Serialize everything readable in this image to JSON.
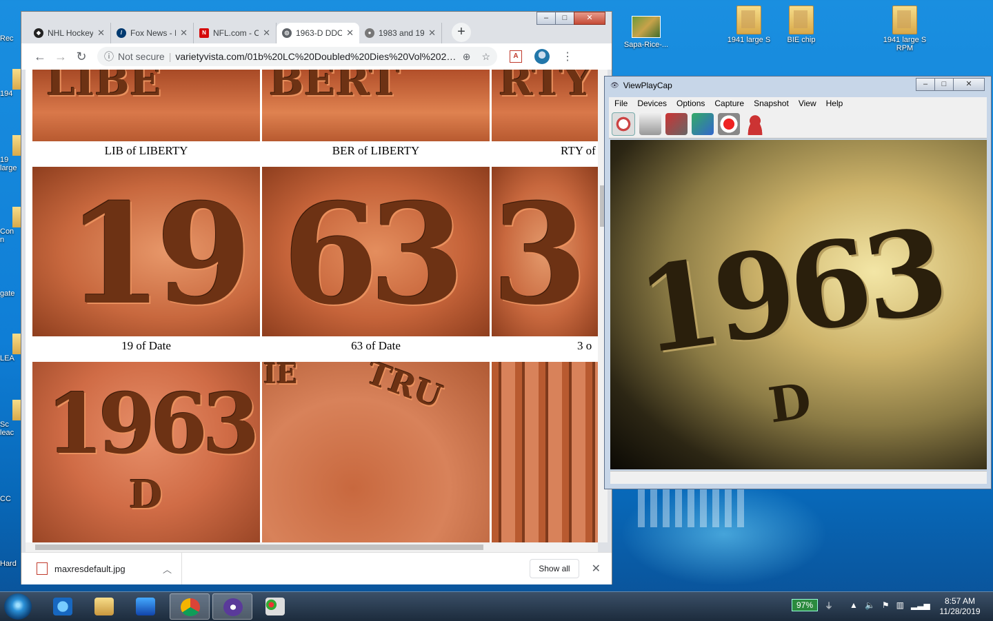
{
  "desktop": {
    "icons": [
      {
        "id": "sapa",
        "label": "Sapa-Rice-..."
      },
      {
        "id": "large-s",
        "label": "1941 large S"
      },
      {
        "id": "bie-chip",
        "label": "BIE chip"
      },
      {
        "id": "large-s-rpm",
        "label": "1941 large S RPM"
      }
    ],
    "left_edge_labels": [
      "Rec",
      "194",
      "19\nlarge",
      "Con\nn",
      "gate",
      "LEA",
      "Sc\nleac",
      "CC",
      "Hard"
    ]
  },
  "chrome": {
    "tabs": [
      {
        "label": "NHL Hockey",
        "favicon": "nhl-icon",
        "color": "#222"
      },
      {
        "label": "Fox News - I",
        "favicon": "fox-icon",
        "color": "#003a70"
      },
      {
        "label": "NFL.com - O",
        "favicon": "nfl-icon",
        "color": "#d50a0a"
      },
      {
        "label": "1963-D DDO",
        "favicon": "globe-icon",
        "color": "#5f6368"
      },
      {
        "label": "1983 and 19",
        "favicon": "coin-icon",
        "color": "#777"
      }
    ],
    "new_tab": "+",
    "security": "Not secure",
    "url": "varietyvista.com/01b%20LC%20Doubled%20Dies%20Vol%202/196...",
    "download": {
      "file": "maxresdefault.jpg",
      "show_all": "Show all"
    }
  },
  "page": {
    "row1_captions": [
      "LIB of LIBERTY",
      "BER of LIBERTY",
      "RTY of"
    ],
    "row2_captions": [
      "19 of Date",
      "63 of Date",
      "3 o"
    ],
    "photo_text": {
      "r1a": "LIBE",
      "r1b": "BERT",
      "r1c": "RTY",
      "r2a": "19",
      "r2b": "63",
      "r2c": "3",
      "r3a": "1963",
      "r3a_mint": "D",
      "r3b": "TRU",
      "r3b2": "IE"
    }
  },
  "viewplaycap": {
    "title": "ViewPlayCap",
    "menu": [
      "File",
      "Devices",
      "Options",
      "Capture",
      "Snapshot",
      "View",
      "Help"
    ],
    "video_digits": "1963",
    "video_mint": "D"
  },
  "taskbar": {
    "battery": "97%",
    "time": "8:57 AM",
    "date": "11/28/2019"
  }
}
